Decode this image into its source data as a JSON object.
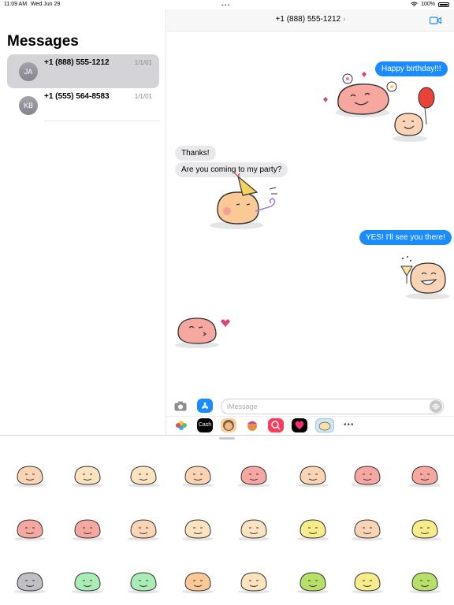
{
  "status_bar": {
    "time": "11:09 AM",
    "date": "Wed Jun 29",
    "battery": "100%"
  },
  "sidebar": {
    "title": "Messages",
    "conversations": [
      {
        "initials": "JA",
        "name": "+1 (888) 555-1212",
        "date": "1/1/01",
        "selected": true
      },
      {
        "initials": "KB",
        "name": "+1 (555) 564-8583",
        "date": "1/1/01",
        "selected": false
      }
    ]
  },
  "chat": {
    "header": {
      "title": "+1 (888) 555-1212",
      "chevron": "›",
      "video_icon": "video-camera-icon"
    },
    "messages": [
      {
        "direction": "out",
        "text": "Happy birthday!!!"
      },
      {
        "direction": "in",
        "text": "Thanks!"
      },
      {
        "direction": "in",
        "text": "Are you coming to my party?"
      },
      {
        "direction": "out",
        "text": "YES! I'll see you there!"
      }
    ],
    "stickers": [
      "birthday-blob-sticker",
      "party-hat-blob-sticker",
      "cheers-blob-sticker",
      "kiss-blob-sticker"
    ]
  },
  "composer": {
    "placeholder": "iMessage",
    "apps": [
      "photos-app",
      "apple-cash-app",
      "memoji-app",
      "animoji-app",
      "search-images-app",
      "digital-touch-app",
      "sticker-pack-app"
    ],
    "cash_label": "Cash"
  },
  "colors": {
    "accent": "#1a8cff",
    "incoming": "#e9e9eb",
    "selection": "#d4d4d8"
  },
  "sticker_tray": {
    "rows": [
      [
        "laughing",
        "content",
        "smiling",
        "sleepy",
        "angel",
        "love-hearts",
        "flowers",
        "heart-eyes"
      ],
      [
        "kiss",
        "flirty",
        "tongue-out",
        "pigtails",
        "shocked",
        "yellow-smirk",
        "wide-eyes",
        "grimace"
      ],
      [
        "sleeping",
        "dizzy-green",
        "star-struck",
        "party-hat",
        "idea",
        "question",
        "worried",
        "sick-green"
      ]
    ]
  }
}
